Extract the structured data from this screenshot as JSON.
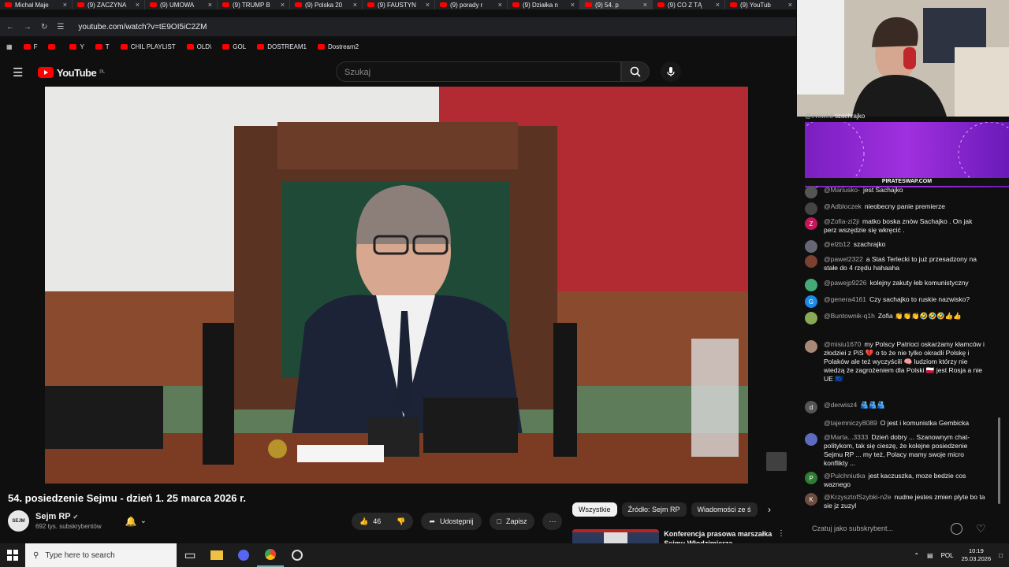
{
  "browser": {
    "tabs": [
      {
        "label": "Michał Maje",
        "active": false
      },
      {
        "label": "(9) ZACZYNA",
        "active": false
      },
      {
        "label": "(9) UMOWA",
        "active": false
      },
      {
        "label": "(9) TRUMP B",
        "active": false
      },
      {
        "label": "(9) Polska 20",
        "active": false
      },
      {
        "label": "(9) FAUSTYN",
        "active": false
      },
      {
        "label": "(9) porady r",
        "active": false
      },
      {
        "label": "(9) Działka n",
        "active": false
      },
      {
        "label": "(9) 54. p",
        "active": true
      },
      {
        "label": "(9) CO Z TĄ",
        "active": false
      },
      {
        "label": "(9) YouTub",
        "active": false
      }
    ],
    "url": "youtube.com/watch?v=tE9OI5iC2ZM",
    "bookmarks": [
      {
        "label": "F"
      },
      {
        "label": ""
      },
      {
        "label": "Y"
      },
      {
        "label": "T"
      },
      {
        "label": "CHIL PLAYLIST"
      },
      {
        "label": "OLD\\"
      },
      {
        "label": "GOL"
      },
      {
        "label": "DOSTREAM1"
      },
      {
        "label": "Dostream2"
      }
    ]
  },
  "youtube": {
    "logo_text": "YouTube",
    "logo_region": "PL",
    "search_placeholder": "Szukaj"
  },
  "video": {
    "title": "54. posiedzenie Sejmu - dzień 1. 25 marca 2026 r."
  },
  "channel": {
    "name": "Sejm RP",
    "subscribers": "692 tys. subskrybentów",
    "avatar_text": "SEJM"
  },
  "actions": {
    "likes": "46",
    "share_label": "Udostępnij",
    "save_label": "Zapisz"
  },
  "chips": [
    "Wszystkie",
    "Źródło: Sejm RP",
    "Wiadomości ze ś"
  ],
  "recommendation": {
    "title": "Konferencja prasowa marszałka Sejmu Włodzimierza"
  },
  "stream_chat": {
    "top_user": "@evowed",
    "top_text": "szachrajko",
    "banner_text": "PIRATESWAP.COM",
    "messages": [
      {
        "user": "@Mariusko-",
        "text": "jest Sachajko",
        "avatar": "",
        "color": "#555"
      },
      {
        "user": "@Adbloczek",
        "text": "nieobecny panie premierze",
        "avatar": "",
        "color": "#444"
      },
      {
        "user": "@Zofia-zi2ji",
        "text": "matko boska znów Sachajko . On jak perz wszędzie się wkręcić .",
        "avatar": "Z",
        "color": "#c2185b"
      },
      {
        "user": "@elżb12",
        "text": "szachrajko",
        "avatar": "",
        "color": "#667"
      },
      {
        "user": "@pawel2322",
        "text": "a Staś Terlecki to już przesadzony na stałe do 4 rzędu hahaaha",
        "avatar": "",
        "color": "#7a4030"
      },
      {
        "user": "@pawejp9226",
        "text": "kolejny zakuty łeb komunistyczny",
        "avatar": "",
        "color": "#4a7"
      },
      {
        "user": "@genera4161",
        "text": "Czy sachajko to ruskie nazwisko?",
        "avatar": "G",
        "color": "#1e88e5"
      },
      {
        "user": "@Buntownik-q1h",
        "text": "Zofia 👏👏👏🤣🤣🤣👍👍",
        "avatar": "",
        "color": "#8a5"
      },
      {
        "user": "@misiu1670",
        "text": "my Polscy Patrioci oskarżamy kłamców i złodziei z PiS 💔 o to że nie tylko okradli Polskę i Polaków ale też wyczyścili 🧠 ludziom którzy nie wiedzą że zagrożeniem dla Polski 🇵🇱 jest Rosja a nie UE 🇪🇺",
        "avatar": "",
        "color": "#a87"
      },
      {
        "user": "@derwisz4",
        "text": "🫂🫂🫂",
        "avatar": "d",
        "color": "#555"
      },
      {
        "user": "@tajemniczy8089",
        "text": "O jest i komunistka Gembicka",
        "avatar": "",
        "color": "#0f0f0f"
      },
      {
        "user": "@Marta...3333",
        "text": "Dzień dobry ... Szanownym chat-politykom, tak się cieszę, że kolejne posiedzenie Sejmu RP ... my też, Polacy mamy swoje micro konflikty ...",
        "avatar": "",
        "color": "#5c6bc0"
      },
      {
        "user": "@Pulchniutka",
        "text": "jest kaczuszka, moze bedzie cos waznego",
        "avatar": "P",
        "color": "#2e7d32"
      },
      {
        "user": "@KrzysztofSzybki-n2e",
        "text": "nudne jestes zmien plyte bo ta sie jz zuzyl",
        "avatar": "K",
        "color": "#6d4c41"
      }
    ],
    "input_placeholder": "Czatuj jako subskrybent..."
  },
  "taskbar": {
    "search_placeholder": "Type here to search",
    "language": "POL",
    "time": "10:19",
    "date": "25.03.2026"
  }
}
